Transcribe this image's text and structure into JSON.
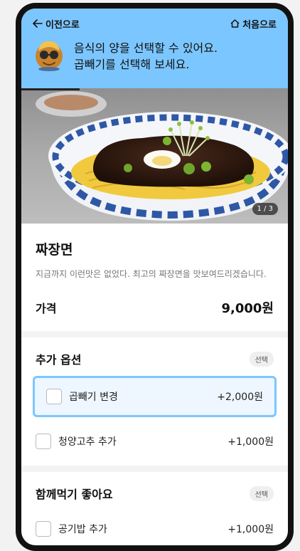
{
  "nav": {
    "back_label": "이전으로",
    "home_label": "처음으로"
  },
  "guide": {
    "line1": "음식의 양을 선택할 수 있어요.",
    "line2": "곱빼기를 선택해 보세요."
  },
  "image": {
    "counter": "1 / 3",
    "icon": "jjajangmyeon-photo"
  },
  "product": {
    "name": "짜장면",
    "description": "지금까지 이런맛은 없었다. 최고의 짜장면을 맛보여드리겠습니다.",
    "price_label": "가격",
    "price": "9,000원"
  },
  "sections": {
    "extra": {
      "title": "추가 옵션",
      "badge": "선택",
      "options": [
        {
          "label": "곱빼기 변경",
          "price": "+2,000원"
        },
        {
          "label": "청양고추 추가",
          "price": "+1,000원"
        }
      ]
    },
    "together": {
      "title": "함께먹기 좋아요",
      "badge": "선택",
      "options": [
        {
          "label": "공기밥 추가",
          "price": "+1,000원"
        }
      ]
    }
  },
  "colors": {
    "accent": "#7cc6ff",
    "highlight_bg": "#eef6ff"
  }
}
